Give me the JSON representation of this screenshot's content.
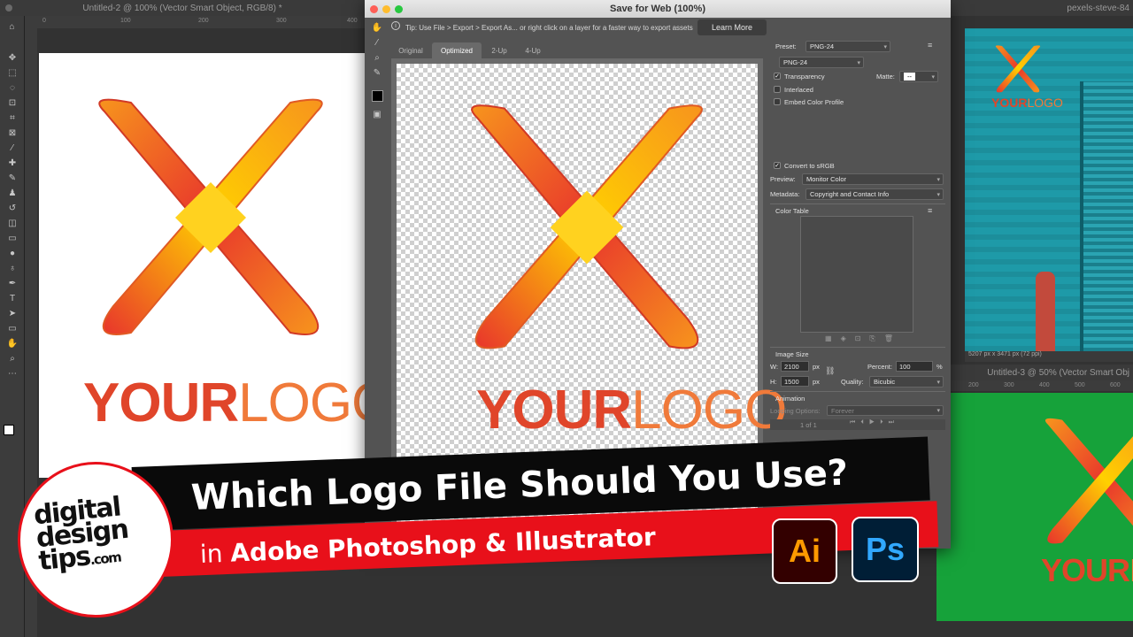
{
  "left_doc": {
    "title": "Untitled-2 @ 100% (Vector Smart Object, RGB/8) *",
    "ruler_ticks": [
      "0",
      "100",
      "200",
      "300",
      "400"
    ]
  },
  "dialog": {
    "title": "Save for Web (100%)",
    "tip": "Tip: Use File > Export > Export As... or right click on a layer for a faster way to export assets",
    "learn_more": "Learn More",
    "tabs": [
      "Original",
      "Optimized",
      "2-Up",
      "4-Up"
    ],
    "active_tab": "Optimized",
    "preset_label": "Preset:",
    "preset_value": "PNG-24",
    "format_value": "PNG-24",
    "transparency_label": "Transparency",
    "matte_label": "Matte:",
    "matte_value": "--",
    "interlaced_label": "Interlaced",
    "embed_label": "Embed Color Profile",
    "convert_label": "Convert to sRGB",
    "preview_label": "Preview:",
    "preview_value": "Monitor Color",
    "metadata_label": "Metadata:",
    "metadata_value": "Copyright and Contact Info",
    "color_table_label": "Color Table",
    "image_size_label": "Image Size",
    "w_label": "W:",
    "w_value": "2100",
    "h_label": "H:",
    "h_value": "1500",
    "px": "px",
    "percent_label": "Percent:",
    "percent_value": "100",
    "percent_unit": "%",
    "quality_label": "Quality:",
    "quality_value": "Bicubic",
    "animation_label": "Animation",
    "looping_label": "Looping Options:",
    "looping_value": "Forever",
    "frame_counter": "1 of 1"
  },
  "right_top_doc": {
    "title": "pexels-steve-84",
    "status": "5207 px x 3471 px (72 ppi)"
  },
  "right_bottom_doc": {
    "title": "Untitled-3 @ 50% (Vector Smart Obj",
    "ruler_ticks": [
      "200",
      "300",
      "400",
      "500",
      "600"
    ]
  },
  "logo": {
    "your": "YOUR",
    "logo": "LOGO"
  },
  "banner": {
    "headline": "Which Logo File Should You Use?",
    "sub_prefix": "in ",
    "sub_bold": "Adobe Photoshop & Illustrator"
  },
  "brand": {
    "line1": "digital",
    "line2": "design",
    "line3": "tips",
    "line3_suffix": ".com"
  },
  "apps": {
    "ai": "Ai",
    "ps": "Ps"
  },
  "colors": {
    "banner_red": "#e8101a",
    "ai_bg": "#330000",
    "ai_fg": "#ff9a00",
    "ps_bg": "#001e36",
    "ps_fg": "#31a8ff",
    "teal_wall": "#1e9aa8",
    "green_doc": "#16a23a"
  }
}
